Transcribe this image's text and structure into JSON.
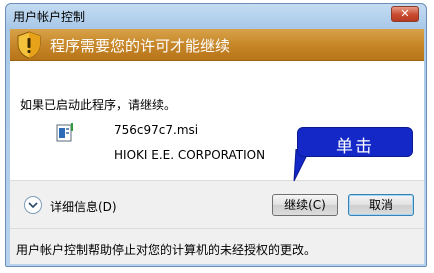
{
  "window": {
    "title": "用户帐户控制",
    "close_label": "✕"
  },
  "banner": {
    "text": "程序需要您的许可才能继续",
    "icon": "warning-shield-icon"
  },
  "content": {
    "prompt": "如果已启动此程序，请继续。",
    "program": {
      "file_name": "756c97c7.msi",
      "publisher": "HIOKI E.E. CORPORATION",
      "icon": "installer-icon"
    }
  },
  "footer": {
    "details_label": "详细信息(D)",
    "continue_label": "继续(C)",
    "cancel_label": "取消"
  },
  "status": {
    "text": "用户帐户控制帮助停止对您的计算机的未经授权的更改。"
  },
  "annotation": {
    "label": "单击"
  },
  "colors": {
    "banner": "#c98a2c",
    "callout": "#1428c8",
    "close": "#c84a2f"
  }
}
